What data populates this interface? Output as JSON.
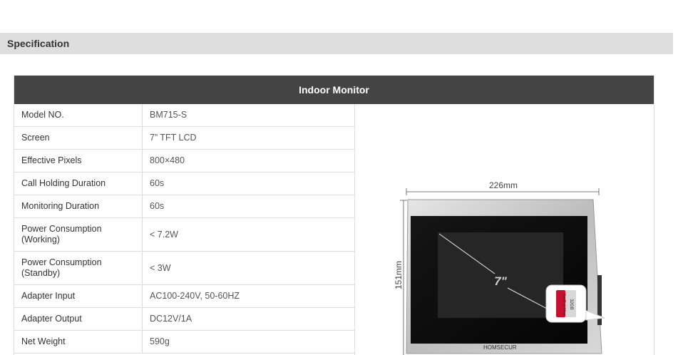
{
  "section": {
    "title": "Specification"
  },
  "table": {
    "title": "Indoor Monitor",
    "rows": [
      {
        "label": "Model NO.",
        "value": "BM715-S"
      },
      {
        "label": "Screen",
        "value": "7” TFT LCD"
      },
      {
        "label": "Effective Pixels",
        "value": "800×480"
      },
      {
        "label": "Call Holding Duration",
        "value": "60s"
      },
      {
        "label": "Monitoring Duration",
        "value": "60s"
      },
      {
        "label": "Power Consumption\n(Working)",
        "value": "< 7.2W"
      },
      {
        "label": "Power Consumption\n(Standby)",
        "value": "< 3W"
      },
      {
        "label": "Adapter Input",
        "value": "AC100-240V, 50-60HZ"
      },
      {
        "label": "Adapter Output",
        "value": "DC12V/1A"
      },
      {
        "label": "Net Weight",
        "value": "590g"
      }
    ]
  },
  "product_image": {
    "width_label": "226mm",
    "height_label": "151mm",
    "screen_size_label": "7\"",
    "brand": "HOMSECUR",
    "sd_card_brand": "SanDisk Ultra",
    "sd_card_capacity": "32GB",
    "colors": {
      "frame": "#c8c8c8",
      "screen": "#0a0a0a",
      "sd_red": "#c8102e"
    }
  }
}
